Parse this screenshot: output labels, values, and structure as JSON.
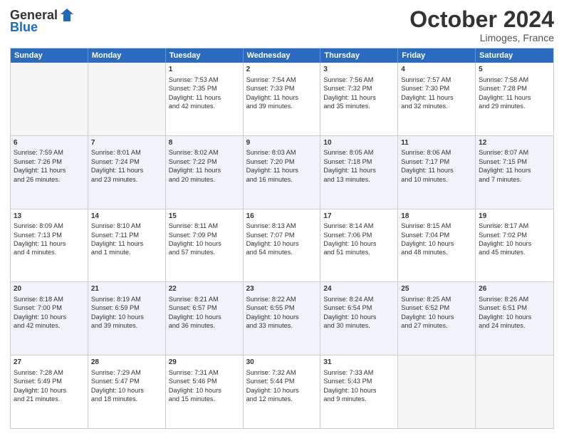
{
  "header": {
    "logo_general": "General",
    "logo_blue": "Blue",
    "month_title": "October 2024",
    "location": "Limoges, France"
  },
  "days_of_week": [
    "Sunday",
    "Monday",
    "Tuesday",
    "Wednesday",
    "Thursday",
    "Friday",
    "Saturday"
  ],
  "rows": [
    {
      "cells": [
        {
          "day": "",
          "empty": true
        },
        {
          "day": "",
          "empty": true
        },
        {
          "day": "1",
          "line1": "Sunrise: 7:53 AM",
          "line2": "Sunset: 7:35 PM",
          "line3": "Daylight: 11 hours",
          "line4": "and 42 minutes."
        },
        {
          "day": "2",
          "line1": "Sunrise: 7:54 AM",
          "line2": "Sunset: 7:33 PM",
          "line3": "Daylight: 11 hours",
          "line4": "and 39 minutes."
        },
        {
          "day": "3",
          "line1": "Sunrise: 7:56 AM",
          "line2": "Sunset: 7:32 PM",
          "line3": "Daylight: 11 hours",
          "line4": "and 35 minutes."
        },
        {
          "day": "4",
          "line1": "Sunrise: 7:57 AM",
          "line2": "Sunset: 7:30 PM",
          "line3": "Daylight: 11 hours",
          "line4": "and 32 minutes."
        },
        {
          "day": "5",
          "line1": "Sunrise: 7:58 AM",
          "line2": "Sunset: 7:28 PM",
          "line3": "Daylight: 11 hours",
          "line4": "and 29 minutes."
        }
      ]
    },
    {
      "alt": true,
      "cells": [
        {
          "day": "6",
          "line1": "Sunrise: 7:59 AM",
          "line2": "Sunset: 7:26 PM",
          "line3": "Daylight: 11 hours",
          "line4": "and 26 minutes."
        },
        {
          "day": "7",
          "line1": "Sunrise: 8:01 AM",
          "line2": "Sunset: 7:24 PM",
          "line3": "Daylight: 11 hours",
          "line4": "and 23 minutes."
        },
        {
          "day": "8",
          "line1": "Sunrise: 8:02 AM",
          "line2": "Sunset: 7:22 PM",
          "line3": "Daylight: 11 hours",
          "line4": "and 20 minutes."
        },
        {
          "day": "9",
          "line1": "Sunrise: 8:03 AM",
          "line2": "Sunset: 7:20 PM",
          "line3": "Daylight: 11 hours",
          "line4": "and 16 minutes."
        },
        {
          "day": "10",
          "line1": "Sunrise: 8:05 AM",
          "line2": "Sunset: 7:18 PM",
          "line3": "Daylight: 11 hours",
          "line4": "and 13 minutes."
        },
        {
          "day": "11",
          "line1": "Sunrise: 8:06 AM",
          "line2": "Sunset: 7:17 PM",
          "line3": "Daylight: 11 hours",
          "line4": "and 10 minutes."
        },
        {
          "day": "12",
          "line1": "Sunrise: 8:07 AM",
          "line2": "Sunset: 7:15 PM",
          "line3": "Daylight: 11 hours",
          "line4": "and 7 minutes."
        }
      ]
    },
    {
      "cells": [
        {
          "day": "13",
          "line1": "Sunrise: 8:09 AM",
          "line2": "Sunset: 7:13 PM",
          "line3": "Daylight: 11 hours",
          "line4": "and 4 minutes."
        },
        {
          "day": "14",
          "line1": "Sunrise: 8:10 AM",
          "line2": "Sunset: 7:11 PM",
          "line3": "Daylight: 11 hours",
          "line4": "and 1 minute."
        },
        {
          "day": "15",
          "line1": "Sunrise: 8:11 AM",
          "line2": "Sunset: 7:09 PM",
          "line3": "Daylight: 10 hours",
          "line4": "and 57 minutes."
        },
        {
          "day": "16",
          "line1": "Sunrise: 8:13 AM",
          "line2": "Sunset: 7:07 PM",
          "line3": "Daylight: 10 hours",
          "line4": "and 54 minutes."
        },
        {
          "day": "17",
          "line1": "Sunrise: 8:14 AM",
          "line2": "Sunset: 7:06 PM",
          "line3": "Daylight: 10 hours",
          "line4": "and 51 minutes."
        },
        {
          "day": "18",
          "line1": "Sunrise: 8:15 AM",
          "line2": "Sunset: 7:04 PM",
          "line3": "Daylight: 10 hours",
          "line4": "and 48 minutes."
        },
        {
          "day": "19",
          "line1": "Sunrise: 8:17 AM",
          "line2": "Sunset: 7:02 PM",
          "line3": "Daylight: 10 hours",
          "line4": "and 45 minutes."
        }
      ]
    },
    {
      "alt": true,
      "cells": [
        {
          "day": "20",
          "line1": "Sunrise: 8:18 AM",
          "line2": "Sunset: 7:00 PM",
          "line3": "Daylight: 10 hours",
          "line4": "and 42 minutes."
        },
        {
          "day": "21",
          "line1": "Sunrise: 8:19 AM",
          "line2": "Sunset: 6:59 PM",
          "line3": "Daylight: 10 hours",
          "line4": "and 39 minutes."
        },
        {
          "day": "22",
          "line1": "Sunrise: 8:21 AM",
          "line2": "Sunset: 6:57 PM",
          "line3": "Daylight: 10 hours",
          "line4": "and 36 minutes."
        },
        {
          "day": "23",
          "line1": "Sunrise: 8:22 AM",
          "line2": "Sunset: 6:55 PM",
          "line3": "Daylight: 10 hours",
          "line4": "and 33 minutes."
        },
        {
          "day": "24",
          "line1": "Sunrise: 8:24 AM",
          "line2": "Sunset: 6:54 PM",
          "line3": "Daylight: 10 hours",
          "line4": "and 30 minutes."
        },
        {
          "day": "25",
          "line1": "Sunrise: 8:25 AM",
          "line2": "Sunset: 6:52 PM",
          "line3": "Daylight: 10 hours",
          "line4": "and 27 minutes."
        },
        {
          "day": "26",
          "line1": "Sunrise: 8:26 AM",
          "line2": "Sunset: 6:51 PM",
          "line3": "Daylight: 10 hours",
          "line4": "and 24 minutes."
        }
      ]
    },
    {
      "cells": [
        {
          "day": "27",
          "line1": "Sunrise: 7:28 AM",
          "line2": "Sunset: 5:49 PM",
          "line3": "Daylight: 10 hours",
          "line4": "and 21 minutes."
        },
        {
          "day": "28",
          "line1": "Sunrise: 7:29 AM",
          "line2": "Sunset: 5:47 PM",
          "line3": "Daylight: 10 hours",
          "line4": "and 18 minutes."
        },
        {
          "day": "29",
          "line1": "Sunrise: 7:31 AM",
          "line2": "Sunset: 5:46 PM",
          "line3": "Daylight: 10 hours",
          "line4": "and 15 minutes."
        },
        {
          "day": "30",
          "line1": "Sunrise: 7:32 AM",
          "line2": "Sunset: 5:44 PM",
          "line3": "Daylight: 10 hours",
          "line4": "and 12 minutes."
        },
        {
          "day": "31",
          "line1": "Sunrise: 7:33 AM",
          "line2": "Sunset: 5:43 PM",
          "line3": "Daylight: 10 hours",
          "line4": "and 9 minutes."
        },
        {
          "day": "",
          "empty": true
        },
        {
          "day": "",
          "empty": true
        }
      ]
    }
  ]
}
